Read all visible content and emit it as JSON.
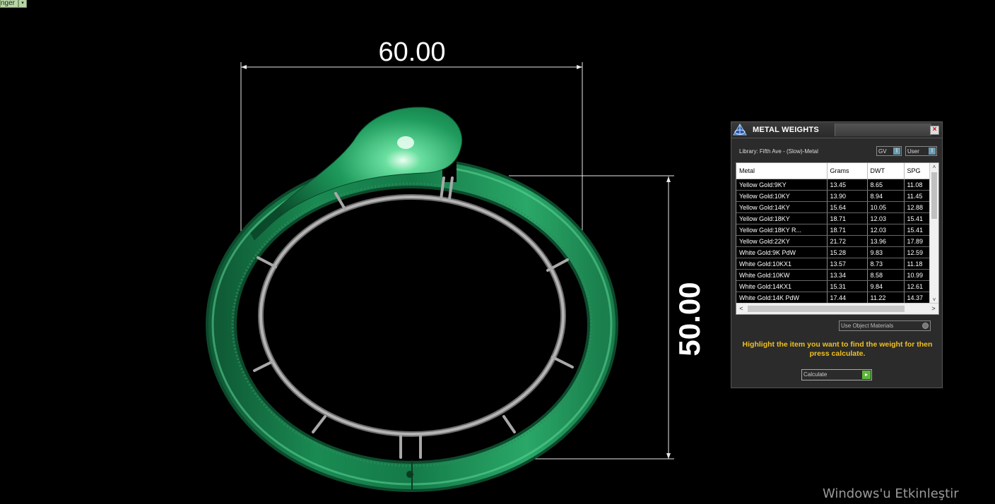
{
  "top_combo": {
    "label": "nger",
    "arrow": "▾"
  },
  "dimensions": {
    "width_label": "60.00",
    "height_label": "50.00"
  },
  "metal_weights": {
    "title": "METAL WEIGHTS",
    "close_glyph": "×",
    "library_label": "Library: Fifth Ave - (Slow)-Metal",
    "gv_toggle": {
      "label": "GV",
      "state": "I"
    },
    "user_toggle": {
      "label": "User",
      "state": "I"
    },
    "columns": [
      "Metal",
      "Grams",
      "DWT",
      "SPG"
    ],
    "rows": [
      {
        "metal": "Yellow Gold:9KY",
        "grams": "13.45",
        "dwt": "8.65",
        "spg": "11.08"
      },
      {
        "metal": "Yellow Gold:10KY",
        "grams": "13.90",
        "dwt": "8.94",
        "spg": "11.45"
      },
      {
        "metal": "Yellow Gold:14KY",
        "grams": "15.64",
        "dwt": "10.05",
        "spg": "12.88"
      },
      {
        "metal": "Yellow Gold:18KY",
        "grams": "18.71",
        "dwt": "12.03",
        "spg": "15.41"
      },
      {
        "metal": "Yellow Gold:18KY R...",
        "grams": "18.71",
        "dwt": "12.03",
        "spg": "15.41"
      },
      {
        "metal": "Yellow Gold:22KY",
        "grams": "21.72",
        "dwt": "13.96",
        "spg": "17.89"
      },
      {
        "metal": "White Gold:9K PdW",
        "grams": "15.28",
        "dwt": "9.83",
        "spg": "12.59"
      },
      {
        "metal": "White Gold:10KX1",
        "grams": "13.57",
        "dwt": "8.73",
        "spg": "11.18"
      },
      {
        "metal": "White Gold:10KW",
        "grams": "13.34",
        "dwt": "8.58",
        "spg": "10.99"
      },
      {
        "metal": "White Gold:14KX1",
        "grams": "15.31",
        "dwt": "9.84",
        "spg": "12.61"
      },
      {
        "metal": "White Gold:14K PdW",
        "grams": "17.44",
        "dwt": "11.22",
        "spg": "14.37"
      }
    ],
    "scroll": {
      "up": "˄",
      "down": "˅",
      "left": "<",
      "right": ">"
    },
    "use_object_materials": "Use Object Materials",
    "hint": "Highlight the item you want to find the weight for then press calculate.",
    "calculate_label": "Calculate",
    "calculate_glyph": "▸"
  },
  "watermark": "Windows'u Etkinleştir",
  "colors": {
    "ring_green": "#1f8a55",
    "ring_highlight": "#7fe0a8",
    "inner_metal": "#9a9a9a",
    "hint_text": "#f0c020"
  }
}
